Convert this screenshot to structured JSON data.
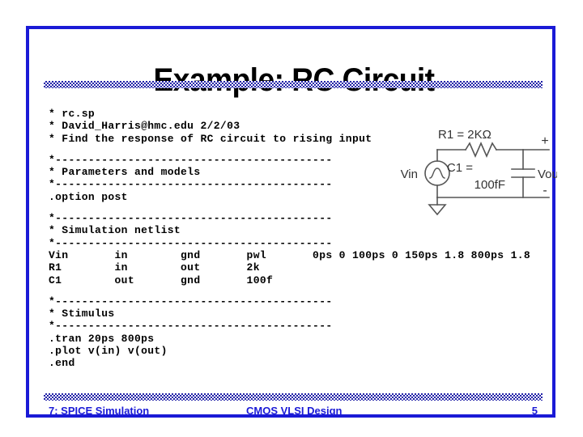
{
  "slide": {
    "title": "Example: RC Circuit",
    "border_color": "#1a1ad6",
    "rule_color": "#2222a8",
    "background_color": "#ffffff"
  },
  "code": {
    "lines": [
      "* rc.sp",
      "* David_Harris@hmc.edu 2/2/03",
      "* Find the response of RC circuit to rising input",
      "",
      "*------------------------------------------",
      "* Parameters and models",
      "*------------------------------------------",
      ".option post",
      "",
      "*------------------------------------------",
      "* Simulation netlist",
      "*------------------------------------------",
      "Vin       in        gnd       pwl       0ps 0 100ps 0 150ps 1.8 800ps 1.8",
      "R1        in        out       2k",
      "C1        out       gnd       100f",
      "",
      "*------------------------------------------",
      "* Stimulus",
      "*------------------------------------------",
      ".tran 20ps 800ps",
      ".plot v(in) v(out)",
      ".end"
    ]
  },
  "circuit": {
    "resistor_label": "R1 = 2KΩ",
    "capacitor_label_line1": "C1 =",
    "capacitor_label_line2": "100fF",
    "source_label": "Vin",
    "output_label": "Vout",
    "plus_sign": "+",
    "minus_sign": "-",
    "line_color": "#555555"
  },
  "footer": {
    "left": "7: SPICE Simulation",
    "center": "CMOS VLSI Design",
    "page": "5",
    "color": "#1a1ad6"
  }
}
